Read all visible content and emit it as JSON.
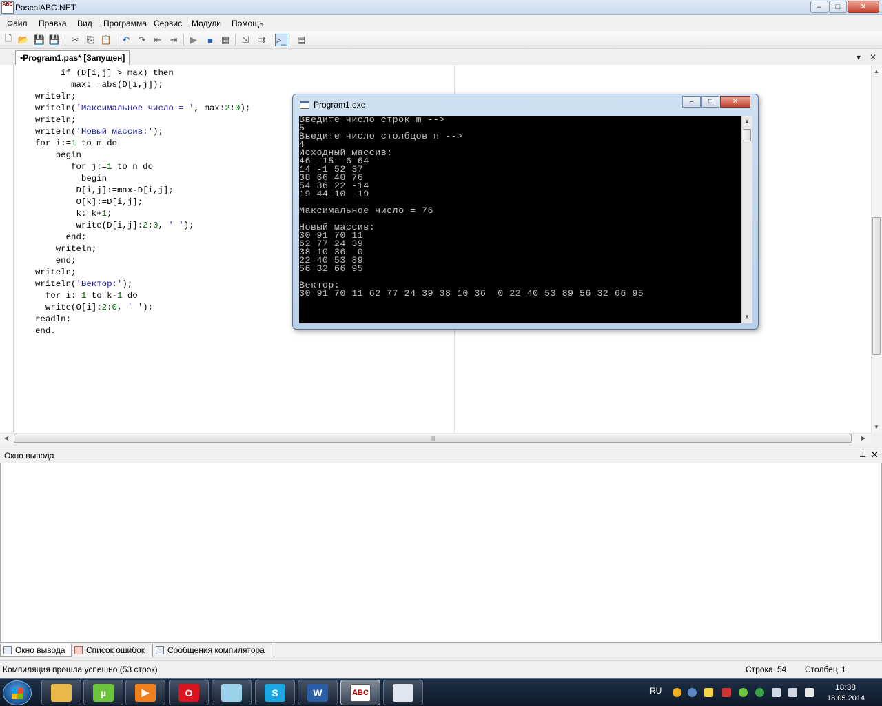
{
  "window": {
    "title": "PascalABC.NET",
    "icon_text": "ABC",
    "background_title": "",
    "minimize": "–",
    "maximize": "□",
    "close": "✕"
  },
  "menu": [
    "Файл",
    "Правка",
    "Вид",
    "Программа",
    "Сервис",
    "Модули",
    "Помощь"
  ],
  "toolbar": {
    "icons": [
      "new-file-icon",
      "open-file-icon",
      "save-icon",
      "save-all-icon",
      "cut-icon",
      "copy-icon",
      "paste-icon",
      "undo-icon",
      "redo-icon",
      "indent-left-icon",
      "indent-right-icon",
      "run-icon",
      "stop-icon",
      "compile-icon",
      "step-into-icon",
      "step-over-icon",
      "console-icon",
      "debug-window-icon"
    ]
  },
  "tab": {
    "label": "•Program1.pas* [Запущен]",
    "dropdown": "▾",
    "close": "✕"
  },
  "editor": {
    "lines": [
      [
        {
          "t": "     if (D[i,j] > max) then",
          "c": "kw"
        }
      ],
      [
        {
          "t": "       max:= abs(D[i,j]);",
          "c": "kw"
        }
      ],
      [
        {
          "t": "writeln;",
          "c": "kw"
        }
      ],
      [
        {
          "t": "writeln(",
          "c": "kw"
        },
        {
          "t": "'Максимальное число = '",
          "c": "str"
        },
        {
          "t": ", max:",
          "c": "kw"
        },
        {
          "t": "2",
          "c": "num"
        },
        {
          "t": ":",
          "c": "kw"
        },
        {
          "t": "0",
          "c": "num"
        },
        {
          "t": ");",
          "c": "kw"
        }
      ],
      [
        {
          "t": "writeln;",
          "c": "kw"
        }
      ],
      [
        {
          "t": "writeln(",
          "c": "kw"
        },
        {
          "t": "'Новый массив:'",
          "c": "str"
        },
        {
          "t": ");",
          "c": "kw"
        }
      ],
      [
        {
          "t": "for i:=",
          "c": "kw"
        },
        {
          "t": "1",
          "c": "num"
        },
        {
          "t": " to m do",
          "c": "kw"
        }
      ],
      [
        {
          "t": "    begin",
          "c": "kw"
        }
      ],
      [
        {
          "t": "       for j:=",
          "c": "kw"
        },
        {
          "t": "1",
          "c": "num"
        },
        {
          "t": " to n do",
          "c": "kw"
        }
      ],
      [
        {
          "t": "         begin",
          "c": "kw"
        }
      ],
      [
        {
          "t": "        D[i,j]:=max-D[i,j];",
          "c": "kw"
        }
      ],
      [
        {
          "t": "        O[k]:=D[i,j];",
          "c": "kw"
        }
      ],
      [
        {
          "t": "        k:=k+",
          "c": "kw"
        },
        {
          "t": "1",
          "c": "num"
        },
        {
          "t": ";",
          "c": "kw"
        }
      ],
      [
        {
          "t": "        write(D[i,j]:",
          "c": "kw"
        },
        {
          "t": "2",
          "c": "num"
        },
        {
          "t": ":",
          "c": "kw"
        },
        {
          "t": "0",
          "c": "num"
        },
        {
          "t": ", ",
          "c": "kw"
        },
        {
          "t": "' '",
          "c": "str"
        },
        {
          "t": ");",
          "c": "kw"
        }
      ],
      [
        {
          "t": "      end;",
          "c": "kw"
        }
      ],
      [
        {
          "t": "    writeln;",
          "c": "kw"
        }
      ],
      [
        {
          "t": "    end;",
          "c": "kw"
        }
      ],
      [
        {
          "t": "writeln;",
          "c": "kw"
        }
      ],
      [
        {
          "t": "writeln(",
          "c": "kw"
        },
        {
          "t": "'Вектор:'",
          "c": "str"
        },
        {
          "t": ");",
          "c": "kw"
        }
      ],
      [
        {
          "t": "  for i:=",
          "c": "kw"
        },
        {
          "t": "1",
          "c": "num"
        },
        {
          "t": " to k-",
          "c": "kw"
        },
        {
          "t": "1",
          "c": "num"
        },
        {
          "t": " do",
          "c": "kw"
        }
      ],
      [
        {
          "t": "  write(O[i]:",
          "c": "kw"
        },
        {
          "t": "2",
          "c": "num"
        },
        {
          "t": ":",
          "c": "kw"
        },
        {
          "t": "0",
          "c": "num"
        },
        {
          "t": ", ",
          "c": "kw"
        },
        {
          "t": "' '",
          "c": "str"
        },
        {
          "t": ");",
          "c": "kw"
        }
      ],
      [
        {
          "t": "readln;",
          "c": "kw"
        }
      ],
      [
        {
          "t": "end.",
          "c": "kw"
        }
      ]
    ],
    "hscroll_grip": "|||"
  },
  "console": {
    "title": "Program1.exe",
    "minimize": "–",
    "maximize": "□",
    "close": "✕",
    "lines": [
      "Введите число строк m -->",
      "5",
      "Введите число столбцов n -->",
      "4",
      "Исходный массив:",
      "46 -15  6 64",
      "14 -1 52 37",
      "38 66 40 76",
      "54 36 22 -14",
      "19 44 10 -19",
      "",
      "Максимальное число = 76",
      "",
      "Новый массив:",
      "30 91 70 11",
      "62 77 24 39",
      "38 10 36  0",
      "22 40 53 89",
      "56 32 66 95",
      "",
      "Вектор:",
      "30 91 70 11 62 77 24 39 38 10 36  0 22 40 53 89 56 32 66 95"
    ]
  },
  "output": {
    "title": "Окно вывода",
    "pin": "⊥",
    "close": "✕",
    "tabs": [
      "Окно вывода",
      "Список ошибок",
      "Сообщения компилятора"
    ]
  },
  "status": {
    "message": "Компиляция прошла успешно (53 строк)",
    "line_label": "Строка",
    "line_value": "54",
    "col_label": "Столбец",
    "col_value": "1"
  },
  "taskbar": {
    "apps": [
      {
        "name": "explorer",
        "label": "",
        "color": "#e8b84a"
      },
      {
        "name": "utorrent",
        "label": "µ",
        "color": "#6cc43a"
      },
      {
        "name": "media-player",
        "label": "▶",
        "color": "#f07f1e"
      },
      {
        "name": "opera",
        "label": "O",
        "color": "#d8141e"
      },
      {
        "name": "notepad",
        "label": "",
        "color": "#9ad0ea"
      },
      {
        "name": "skype",
        "label": "S",
        "color": "#1aa6e3"
      },
      {
        "name": "word",
        "label": "W",
        "color": "#2b5ea8"
      },
      {
        "name": "pascalabc",
        "label": "ABC",
        "color": "#ffffff"
      },
      {
        "name": "program-console",
        "label": "",
        "color": "#dfe6ef"
      }
    ],
    "lang": "RU",
    "time": "18:38",
    "date": "18.05.2014"
  }
}
